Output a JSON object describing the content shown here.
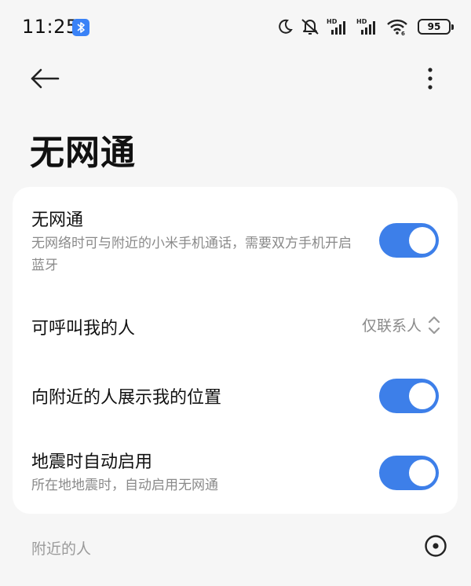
{
  "status_bar": {
    "time": "11:25",
    "battery": "95",
    "icons": [
      "bluetooth-icon",
      "moon-icon",
      "mute-icon",
      "hd-signal-icon",
      "hd-signal-icon",
      "wifi-icon",
      "battery-icon"
    ]
  },
  "header": {
    "title": "无网通",
    "back_icon": "arrow-left-icon",
    "more_icon": "more-vertical-icon"
  },
  "settings": {
    "items": [
      {
        "title": "无网通",
        "subtitle": "无网络时可与附近的小米手机通话，需要双方手机开启蓝牙",
        "toggle": true
      },
      {
        "title": "可呼叫我的人",
        "value": "仅联系人"
      },
      {
        "title": "向附近的人展示我的位置",
        "toggle": true
      },
      {
        "title": "地震时自动启用",
        "subtitle": "所在地地震时，自动启用无网通",
        "toggle": true
      }
    ]
  },
  "nearby": {
    "label": "附近的人",
    "icon": "target-icon"
  },
  "colors": {
    "accent": "#3d7fe9",
    "background": "#f6f6f6",
    "card": "#ffffff",
    "secondary_text": "#8a8a8a"
  }
}
